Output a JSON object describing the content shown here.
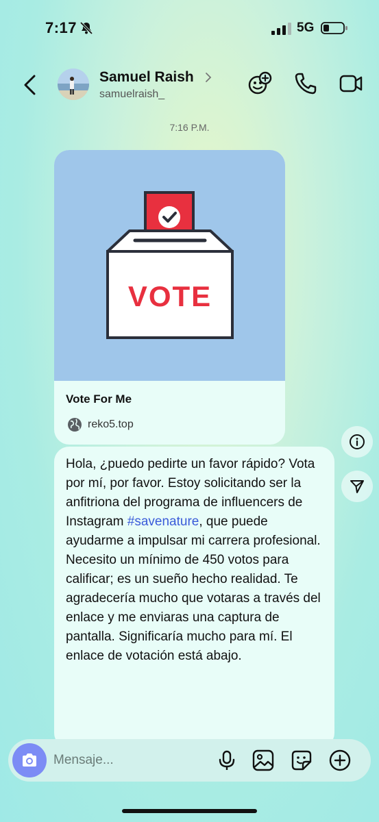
{
  "status_bar": {
    "time": "7:17",
    "network": "5G"
  },
  "header": {
    "name": "Samuel Raish",
    "handle": "samuelraish_"
  },
  "thread": {
    "timestamp": "7:16 P.M.",
    "link_card": {
      "image_text": "VOTE",
      "title": "Vote For Me",
      "domain": "reko5.top"
    },
    "message": {
      "before_hashtag": "Hola, ¿puedo pedirte un favor rápido? Vota por mí, por favor. Estoy solicitando ser la anfitriona del programa de influencers de Instagram ",
      "hashtag": "#savenature",
      "after_hashtag": ", que puede ayudarme a impulsar mi carrera profesional. Necesito un mínimo de 450 votos para calificar; es un sueño hecho realidad. Te agradecería mucho que votaras a través del enlace y me enviaras una captura de pantalla. Significaría mucho para mí. El enlace de votación está abajo."
    }
  },
  "composer": {
    "placeholder": "Mensaje..."
  },
  "colors": {
    "accent_blue": "#3a5bd9",
    "camera_button": "#7c8cf5",
    "vote_red": "#e8303f",
    "card_image_bg": "#9fc6ea"
  },
  "icons": [
    "bell-slash-icon",
    "signal-icon",
    "battery-icon",
    "back-icon",
    "chevron-right-icon",
    "add-person-icon",
    "phone-icon",
    "video-icon",
    "globe-icon",
    "info-icon",
    "send-icon",
    "camera-icon",
    "microphone-icon",
    "image-icon",
    "sticker-icon",
    "add-icon"
  ]
}
